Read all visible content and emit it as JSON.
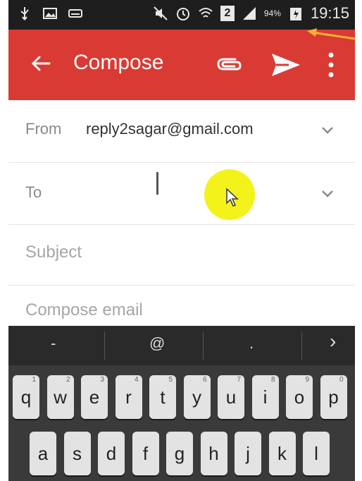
{
  "status_bar": {
    "battery": "94%",
    "time": "19:15",
    "sim": "2",
    "icons": [
      "usb-icon",
      "gallery-icon",
      "keyboard-icon",
      "mute-icon",
      "alarm-icon",
      "wifi-icon",
      "sim2-icon",
      "signal-icon",
      "battery-icon"
    ]
  },
  "app_bar": {
    "title": "Compose",
    "icons": [
      "back-arrow-icon",
      "attach-icon",
      "send-icon",
      "more-vert-icon"
    ],
    "color": "#d93b34"
  },
  "form": {
    "from_label": "From",
    "from_value": "reply2sagar@gmail.com",
    "to_label": "To",
    "subject_placeholder": "Subject",
    "body_placeholder": "Compose email"
  },
  "suggestion_bar": [
    "-",
    "@",
    ".",
    "›"
  ],
  "keyboard": {
    "row1": [
      {
        "key": "q",
        "hint": "1"
      },
      {
        "key": "w",
        "hint": "2"
      },
      {
        "key": "e",
        "hint": "3"
      },
      {
        "key": "r",
        "hint": "4"
      },
      {
        "key": "t",
        "hint": "5"
      },
      {
        "key": "y",
        "hint": "6"
      },
      {
        "key": "u",
        "hint": "7"
      },
      {
        "key": "i",
        "hint": "8"
      },
      {
        "key": "o",
        "hint": "9"
      },
      {
        "key": "p",
        "hint": "0"
      }
    ],
    "row2": [
      "a",
      "s",
      "d",
      "f",
      "g",
      "h",
      "j",
      "k",
      "l"
    ]
  },
  "annotation": {
    "arrow_color": "#f2b233"
  }
}
